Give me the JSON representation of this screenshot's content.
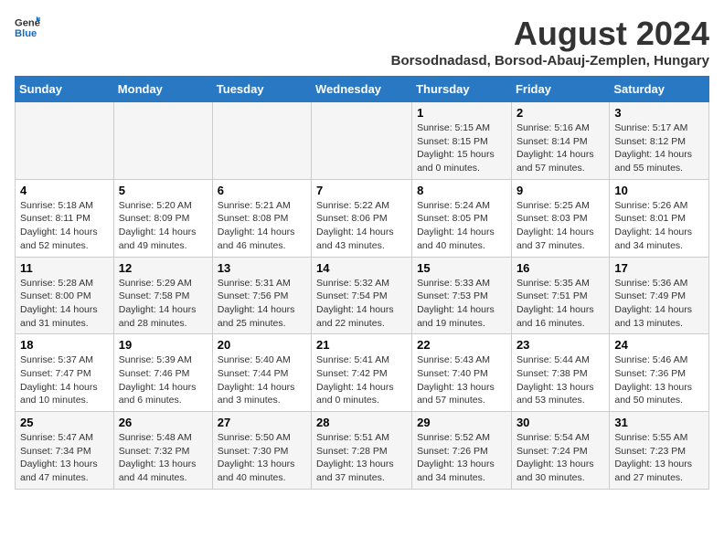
{
  "header": {
    "logo_general": "General",
    "logo_blue": "Blue",
    "main_title": "August 2024",
    "subtitle": "Borsodnadasd, Borsod-Abauj-Zemplen, Hungary"
  },
  "days_of_week": [
    "Sunday",
    "Monday",
    "Tuesday",
    "Wednesday",
    "Thursday",
    "Friday",
    "Saturday"
  ],
  "weeks": [
    [
      {
        "day": "",
        "info": ""
      },
      {
        "day": "",
        "info": ""
      },
      {
        "day": "",
        "info": ""
      },
      {
        "day": "",
        "info": ""
      },
      {
        "day": "1",
        "info": "Sunrise: 5:15 AM\nSunset: 8:15 PM\nDaylight: 15 hours and 0 minutes."
      },
      {
        "day": "2",
        "info": "Sunrise: 5:16 AM\nSunset: 8:14 PM\nDaylight: 14 hours and 57 minutes."
      },
      {
        "day": "3",
        "info": "Sunrise: 5:17 AM\nSunset: 8:12 PM\nDaylight: 14 hours and 55 minutes."
      }
    ],
    [
      {
        "day": "4",
        "info": "Sunrise: 5:18 AM\nSunset: 8:11 PM\nDaylight: 14 hours and 52 minutes."
      },
      {
        "day": "5",
        "info": "Sunrise: 5:20 AM\nSunset: 8:09 PM\nDaylight: 14 hours and 49 minutes."
      },
      {
        "day": "6",
        "info": "Sunrise: 5:21 AM\nSunset: 8:08 PM\nDaylight: 14 hours and 46 minutes."
      },
      {
        "day": "7",
        "info": "Sunrise: 5:22 AM\nSunset: 8:06 PM\nDaylight: 14 hours and 43 minutes."
      },
      {
        "day": "8",
        "info": "Sunrise: 5:24 AM\nSunset: 8:05 PM\nDaylight: 14 hours and 40 minutes."
      },
      {
        "day": "9",
        "info": "Sunrise: 5:25 AM\nSunset: 8:03 PM\nDaylight: 14 hours and 37 minutes."
      },
      {
        "day": "10",
        "info": "Sunrise: 5:26 AM\nSunset: 8:01 PM\nDaylight: 14 hours and 34 minutes."
      }
    ],
    [
      {
        "day": "11",
        "info": "Sunrise: 5:28 AM\nSunset: 8:00 PM\nDaylight: 14 hours and 31 minutes."
      },
      {
        "day": "12",
        "info": "Sunrise: 5:29 AM\nSunset: 7:58 PM\nDaylight: 14 hours and 28 minutes."
      },
      {
        "day": "13",
        "info": "Sunrise: 5:31 AM\nSunset: 7:56 PM\nDaylight: 14 hours and 25 minutes."
      },
      {
        "day": "14",
        "info": "Sunrise: 5:32 AM\nSunset: 7:54 PM\nDaylight: 14 hours and 22 minutes."
      },
      {
        "day": "15",
        "info": "Sunrise: 5:33 AM\nSunset: 7:53 PM\nDaylight: 14 hours and 19 minutes."
      },
      {
        "day": "16",
        "info": "Sunrise: 5:35 AM\nSunset: 7:51 PM\nDaylight: 14 hours and 16 minutes."
      },
      {
        "day": "17",
        "info": "Sunrise: 5:36 AM\nSunset: 7:49 PM\nDaylight: 14 hours and 13 minutes."
      }
    ],
    [
      {
        "day": "18",
        "info": "Sunrise: 5:37 AM\nSunset: 7:47 PM\nDaylight: 14 hours and 10 minutes."
      },
      {
        "day": "19",
        "info": "Sunrise: 5:39 AM\nSunset: 7:46 PM\nDaylight: 14 hours and 6 minutes."
      },
      {
        "day": "20",
        "info": "Sunrise: 5:40 AM\nSunset: 7:44 PM\nDaylight: 14 hours and 3 minutes."
      },
      {
        "day": "21",
        "info": "Sunrise: 5:41 AM\nSunset: 7:42 PM\nDaylight: 14 hours and 0 minutes."
      },
      {
        "day": "22",
        "info": "Sunrise: 5:43 AM\nSunset: 7:40 PM\nDaylight: 13 hours and 57 minutes."
      },
      {
        "day": "23",
        "info": "Sunrise: 5:44 AM\nSunset: 7:38 PM\nDaylight: 13 hours and 53 minutes."
      },
      {
        "day": "24",
        "info": "Sunrise: 5:46 AM\nSunset: 7:36 PM\nDaylight: 13 hours and 50 minutes."
      }
    ],
    [
      {
        "day": "25",
        "info": "Sunrise: 5:47 AM\nSunset: 7:34 PM\nDaylight: 13 hours and 47 minutes."
      },
      {
        "day": "26",
        "info": "Sunrise: 5:48 AM\nSunset: 7:32 PM\nDaylight: 13 hours and 44 minutes."
      },
      {
        "day": "27",
        "info": "Sunrise: 5:50 AM\nSunset: 7:30 PM\nDaylight: 13 hours and 40 minutes."
      },
      {
        "day": "28",
        "info": "Sunrise: 5:51 AM\nSunset: 7:28 PM\nDaylight: 13 hours and 37 minutes."
      },
      {
        "day": "29",
        "info": "Sunrise: 5:52 AM\nSunset: 7:26 PM\nDaylight: 13 hours and 34 minutes."
      },
      {
        "day": "30",
        "info": "Sunrise: 5:54 AM\nSunset: 7:24 PM\nDaylight: 13 hours and 30 minutes."
      },
      {
        "day": "31",
        "info": "Sunrise: 5:55 AM\nSunset: 7:23 PM\nDaylight: 13 hours and 27 minutes."
      }
    ]
  ]
}
